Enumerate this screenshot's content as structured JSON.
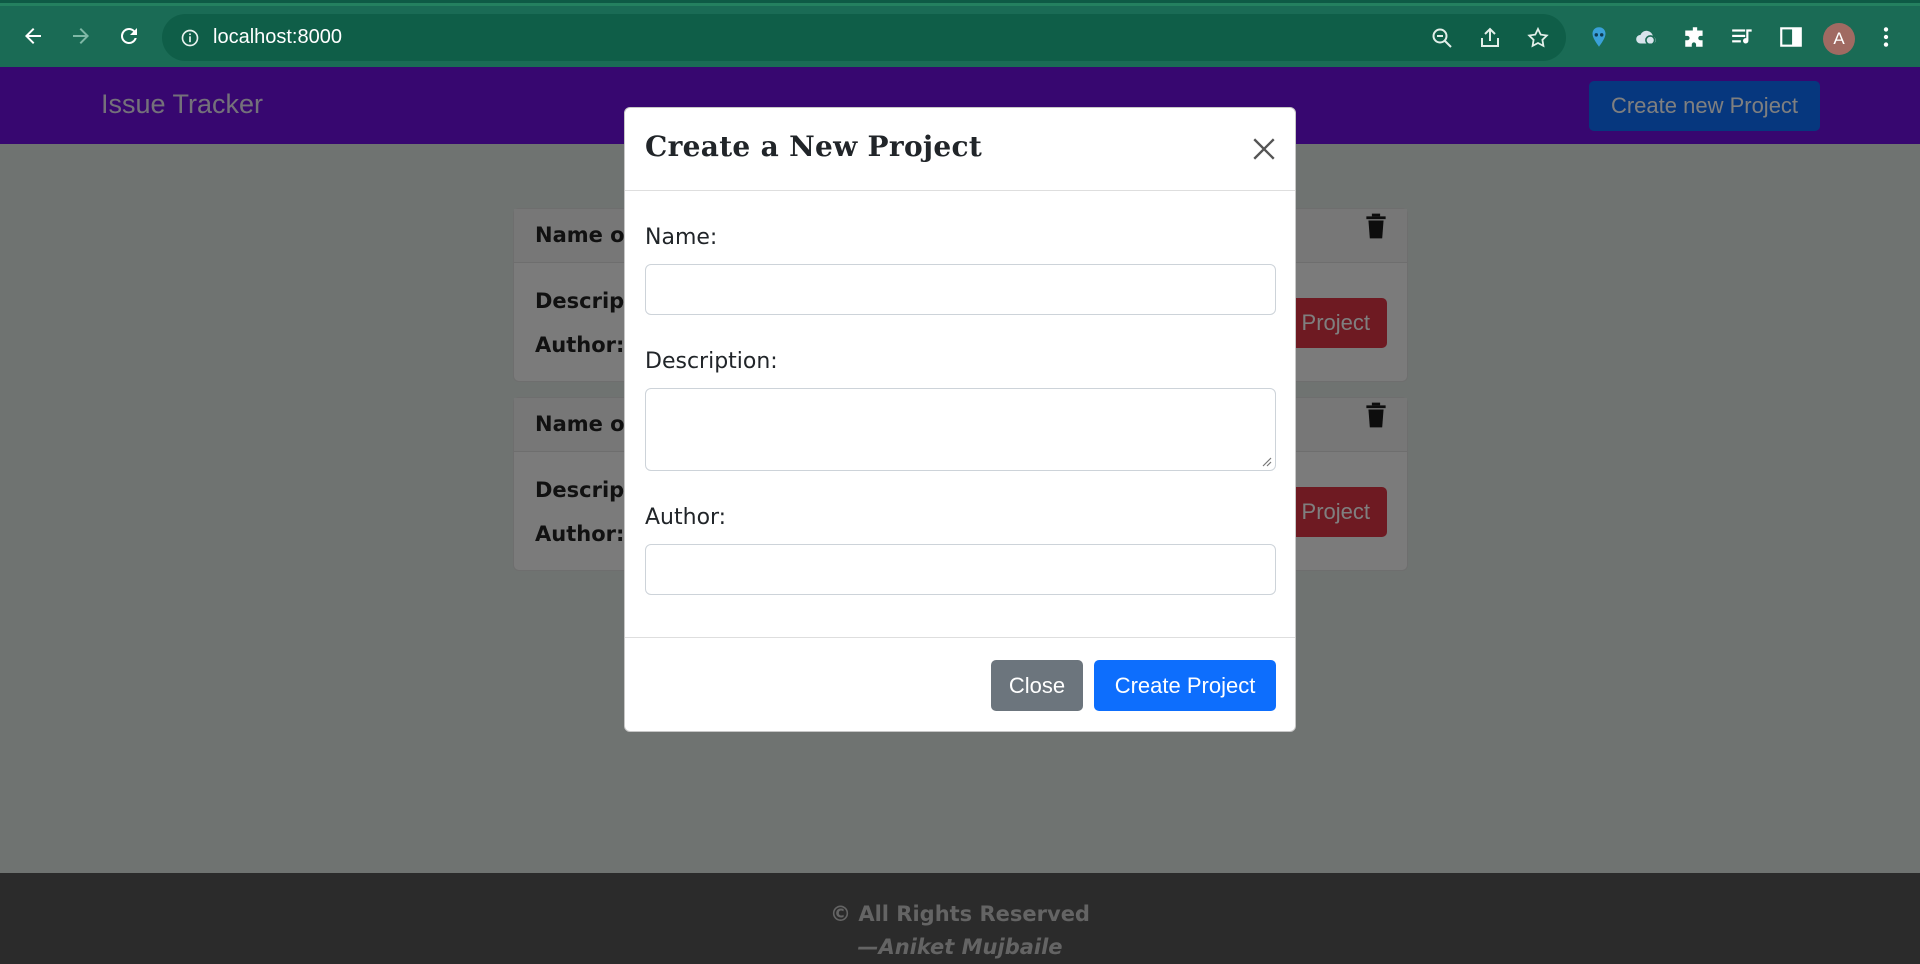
{
  "browser": {
    "url": "localhost:8000",
    "profile_initial": "A"
  },
  "navbar": {
    "brand": "Issue Tracker",
    "create_button": "Create new Project"
  },
  "projects": [
    {
      "name_label": "Name of",
      "description_label": "Descript",
      "author_label": "Author:",
      "view_button": "Project"
    },
    {
      "name_label": "Name of",
      "description_label": "Descript",
      "author_label": "Author:",
      "view_button": "Project"
    }
  ],
  "footer": {
    "copyright": "© All Rights Reserved",
    "signature": "—Aniket Mujbaile"
  },
  "modal": {
    "title": "Create a New Project",
    "name_label": "Name:",
    "name_value": "",
    "description_label": "Description:",
    "description_value": "",
    "author_label": "Author:",
    "author_value": "",
    "close_button": "Close",
    "submit_button": "Create Project"
  },
  "colors": {
    "navbar": "#6f0fe0",
    "primary": "#0d6efd",
    "danger": "#dc3545",
    "secondary": "#6c757d",
    "browser_chrome": "#1a6b55"
  }
}
